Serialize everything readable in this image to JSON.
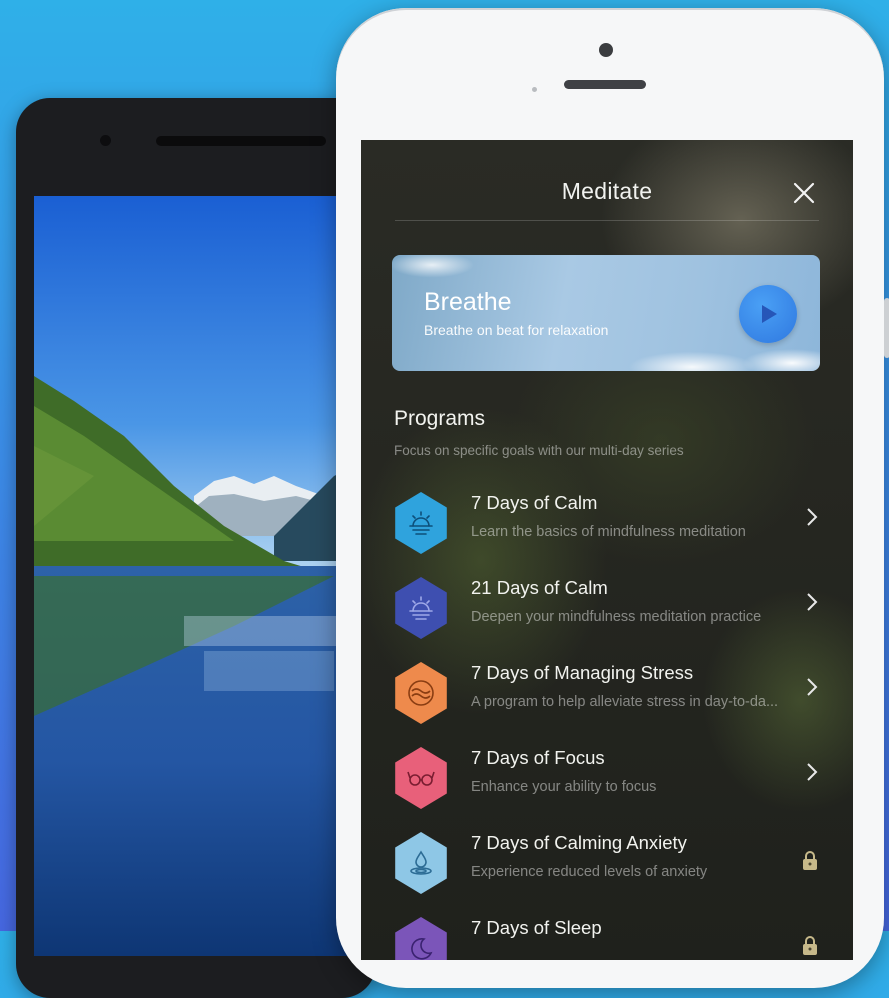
{
  "header": {
    "title": "Meditate"
  },
  "breathe": {
    "title": "Breathe",
    "subtitle": "Breathe on beat for relaxation"
  },
  "programs": {
    "heading": "Programs",
    "subtitle": "Focus on specific goals with our multi-day series",
    "items": [
      {
        "title": "7 Days of Calm",
        "desc": "Learn the basics of mindfulness meditation",
        "color": "#2fa3dd",
        "icon": "sunrise-icon",
        "locked": false
      },
      {
        "title": "21 Days of Calm",
        "desc": "Deepen your mindfulness meditation practice",
        "color": "#3e4fb0",
        "icon": "sunrise-icon",
        "locked": false
      },
      {
        "title": "7 Days of Managing Stress",
        "desc": "A program to help alleviate stress in day-to-da...",
        "color": "#ee8a4c",
        "icon": "waves-icon",
        "locked": false
      },
      {
        "title": "7 Days of Focus",
        "desc": "Enhance your ability to focus",
        "color": "#e8607a",
        "icon": "glasses-icon",
        "locked": false
      },
      {
        "title": "7 Days of Calming Anxiety",
        "desc": "Experience reduced levels of anxiety",
        "color": "#8ec7e6",
        "icon": "water-drop-icon",
        "locked": true
      },
      {
        "title": "7 Days of Sleep",
        "desc": "",
        "color": "#7b55b9",
        "icon": "moon-icon",
        "locked": true
      }
    ]
  },
  "colors": {
    "accent": "#2f78e0",
    "lock": "#c6b98a"
  }
}
